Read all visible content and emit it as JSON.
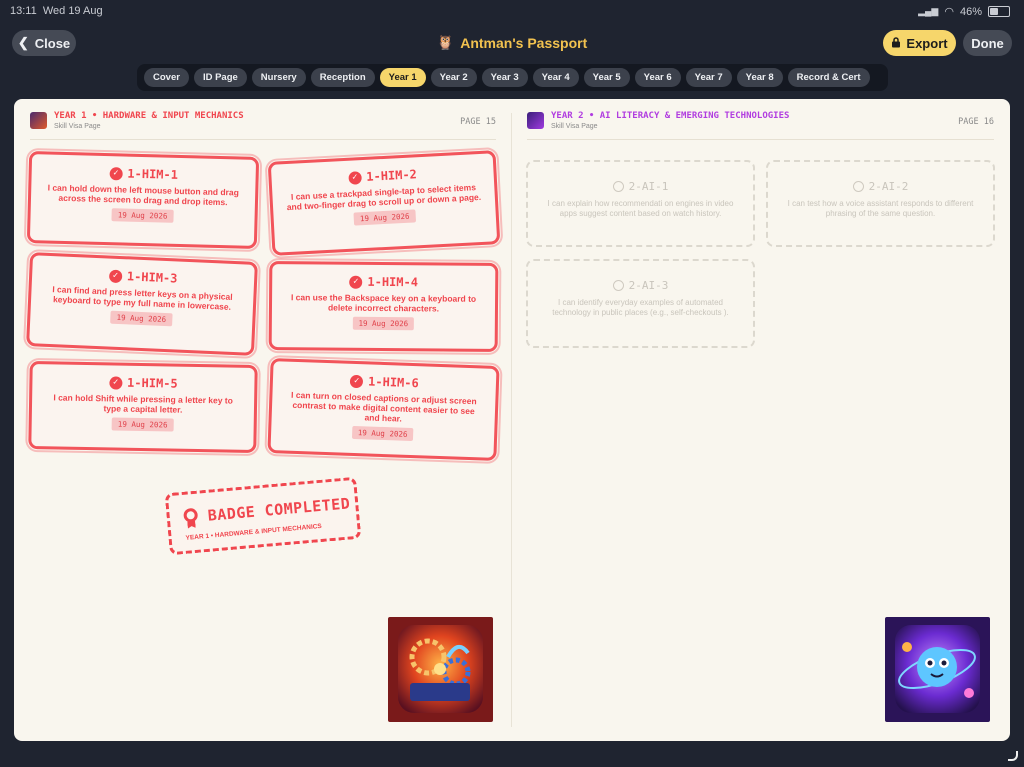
{
  "status": {
    "time": "13:11",
    "date": "Wed 19 Aug",
    "battery": "46%"
  },
  "header": {
    "close_label": "Close",
    "title": "Antman's Passport",
    "export_label": "Export",
    "done_label": "Done"
  },
  "tabs": [
    {
      "label": "Cover",
      "active": false
    },
    {
      "label": "ID Page",
      "active": false
    },
    {
      "label": "Nursery",
      "active": false
    },
    {
      "label": "Reception",
      "active": false
    },
    {
      "label": "Year 1",
      "active": true
    },
    {
      "label": "Year 2",
      "active": false
    },
    {
      "label": "Year 3",
      "active": false
    },
    {
      "label": "Year 4",
      "active": false
    },
    {
      "label": "Year 5",
      "active": false
    },
    {
      "label": "Year 6",
      "active": false
    },
    {
      "label": "Year 7",
      "active": false
    },
    {
      "label": "Year 8",
      "active": false
    },
    {
      "label": "Record & Cert",
      "active": false
    }
  ],
  "left_page": {
    "heading": "YEAR 1 • HARDWARE & INPUT MECHANICS",
    "subtitle": "Skill Visa Page",
    "page_label": "PAGE 15",
    "accent": "#f0464e",
    "stamps": [
      {
        "code": "1-HIM-1",
        "desc": "I can hold down the left mouse button and drag across the screen to drag and drop items.",
        "date": "19 Aug 2026"
      },
      {
        "code": "1-HIM-2",
        "desc": "I can use a trackpad single-tap to select items and two-finger drag to scroll up or down a page.",
        "date": "19 Aug 2026"
      },
      {
        "code": "1-HIM-3",
        "desc": "I can find and press letter keys on a physical keyboard to type my full name in lowercase.",
        "date": "19 Aug 2026"
      },
      {
        "code": "1-HIM-4",
        "desc": "I can use the Backspace key on a keyboard to delete incorrect characters.",
        "date": "19 Aug 2026"
      },
      {
        "code": "1-HIM-5",
        "desc": "I can hold Shift while pressing a letter key to type a capital letter.",
        "date": "19 Aug 2026"
      },
      {
        "code": "1-HIM-6",
        "desc": "I can turn on closed captions or adjust screen contrast to make digital content easier to see and hear.",
        "date": "19 Aug 2026"
      }
    ],
    "badge": {
      "title": "BADGE COMPLETED",
      "subtitle": "YEAR 1 • HARDWARE & INPUT MECHANICS"
    }
  },
  "right_page": {
    "heading": "YEAR 2 • AI LITERACY & EMERGING TECHNOLOGIES",
    "subtitle": "Skill Visa Page",
    "page_label": "PAGE 16",
    "accent": "#b13de0",
    "skills": [
      {
        "code": "2-AI-1",
        "desc": "I can explain how recommendati on engines in video apps suggest content based on watch history."
      },
      {
        "code": "2-AI-2",
        "desc": "I can test how a voice assistant responds to different phrasing of the same question."
      },
      {
        "code": "2-AI-3",
        "desc": "I can identify everyday examples of automated technology in public places (e.g., self-checkouts )."
      }
    ]
  }
}
